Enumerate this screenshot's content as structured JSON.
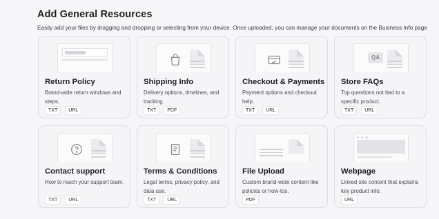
{
  "header": {
    "title": "Add General Resources",
    "subtitle": "Easily add your files by dragging and dropping or selecting from your device. Once uploaded, you can manage your documents on the Business Info page"
  },
  "cards": [
    {
      "title": "Return Policy",
      "desc": "Brand-wide return windows and steps.",
      "tags": [
        "TXT",
        "URL"
      ],
      "icon": "document-preview-icon"
    },
    {
      "title": "Shipping Info",
      "desc": "Delivery options, timelines, and tracking.",
      "tags": [
        "TXT",
        "PDF"
      ],
      "icon": "shopping-bag-icon"
    },
    {
      "title": "Checkout & Payments",
      "desc": "Payment options and checkout help.",
      "tags": [
        "TXT",
        "URL"
      ],
      "icon": "credit-card-icon"
    },
    {
      "title": "Store FAQs",
      "desc": "Top questions not tied to a specific product.",
      "tags": [
        "TXT",
        "URL"
      ],
      "icon": "qa-icon",
      "icon_text": "QA"
    },
    {
      "title": "Contact support",
      "desc": "How to reach your support team.",
      "tags": [
        "TXT",
        "URL"
      ],
      "icon": "help-circle-icon"
    },
    {
      "title": "Terms & Conditions",
      "desc": "Legal terms, privacy policy, and data use.",
      "tags": [
        "TXT",
        "URL"
      ],
      "icon": "terms-document-icon"
    },
    {
      "title": "File Upload",
      "desc": "Custom brand-wide content like policies or how-tos.",
      "tags": [
        "PDF"
      ],
      "icon": "file-lines-icon"
    },
    {
      "title": "Webpage",
      "desc": "Linked site content that explains key product info.",
      "tags": [
        "URL"
      ],
      "icon": "webpage-icon"
    }
  ]
}
